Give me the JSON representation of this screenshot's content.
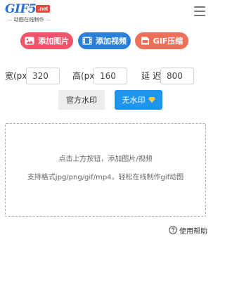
{
  "header": {
    "logo_main": "GIF5",
    "logo_badge": ".net",
    "logo_tagline": "动图在线制作",
    "menu_icon": "hamburger-menu-icon"
  },
  "actions": {
    "add_image": "添加图片",
    "add_video": "添加视频",
    "gif_compress": "GIF压缩"
  },
  "settings": {
    "width_label": "宽(px)",
    "width_value": "320",
    "height_label": "高(px)",
    "height_value": "160",
    "delay_label": "延迟",
    "delay_value": "800"
  },
  "watermark": {
    "official_label": "官方水印",
    "none_label": "无水印",
    "none_icon": "diamond-icon"
  },
  "drop_zone": {
    "line1": "点击上方按钮，添加图片/视频",
    "line2": "支持格式jpg/png/gif/mp4，轻松在线制作gif动图"
  },
  "help": {
    "label": "使用帮助",
    "icon": "question-circle-icon"
  },
  "colors": {
    "image_btn": "#f0556b",
    "video_btn": "#2a7fd9",
    "compress_btn": "#ec6f57",
    "primary": "#1e96f0"
  }
}
